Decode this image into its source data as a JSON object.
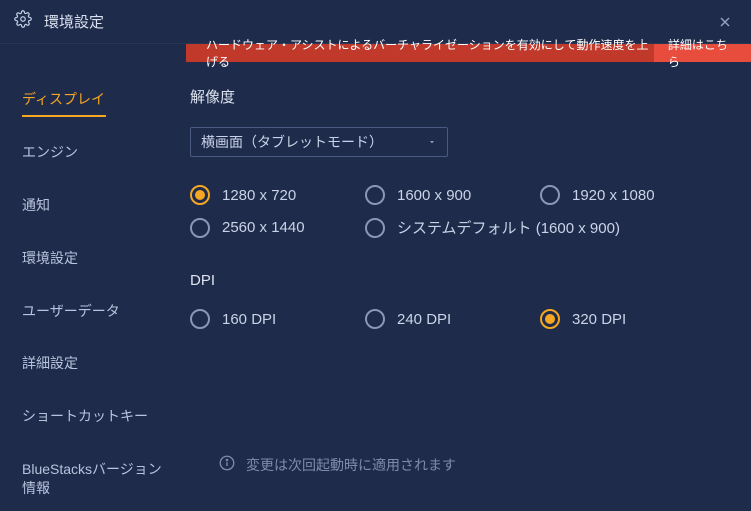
{
  "window": {
    "title": "環境設定"
  },
  "banner": {
    "message": "ハードウェア・アシストによるバーチャライゼーションを有効にして動作速度を上げる",
    "link": "詳細はこちら"
  },
  "sidebar": {
    "items": [
      {
        "label": "ディスプレイ"
      },
      {
        "label": "エンジン"
      },
      {
        "label": "通知"
      },
      {
        "label": "環境設定"
      },
      {
        "label": "ユーザーデータ"
      },
      {
        "label": "詳細設定"
      },
      {
        "label": "ショートカットキー"
      },
      {
        "label": "BlueStacksバージョン情報"
      }
    ]
  },
  "main": {
    "resolution_label": "解像度",
    "orientation_value": "横画面（タブレットモード）",
    "res_options": {
      "r0": "1280 x 720",
      "r1": "1600 x 900",
      "r2": "1920 x 1080",
      "r3": "2560 x 1440",
      "r4": "システムデフォルト (1600 x 900)"
    },
    "dpi_label": "DPI",
    "dpi_options": {
      "d0": "160 DPI",
      "d1": "240 DPI",
      "d2": "320 DPI"
    },
    "footer_note": "変更は次回起動時に適用されます"
  }
}
